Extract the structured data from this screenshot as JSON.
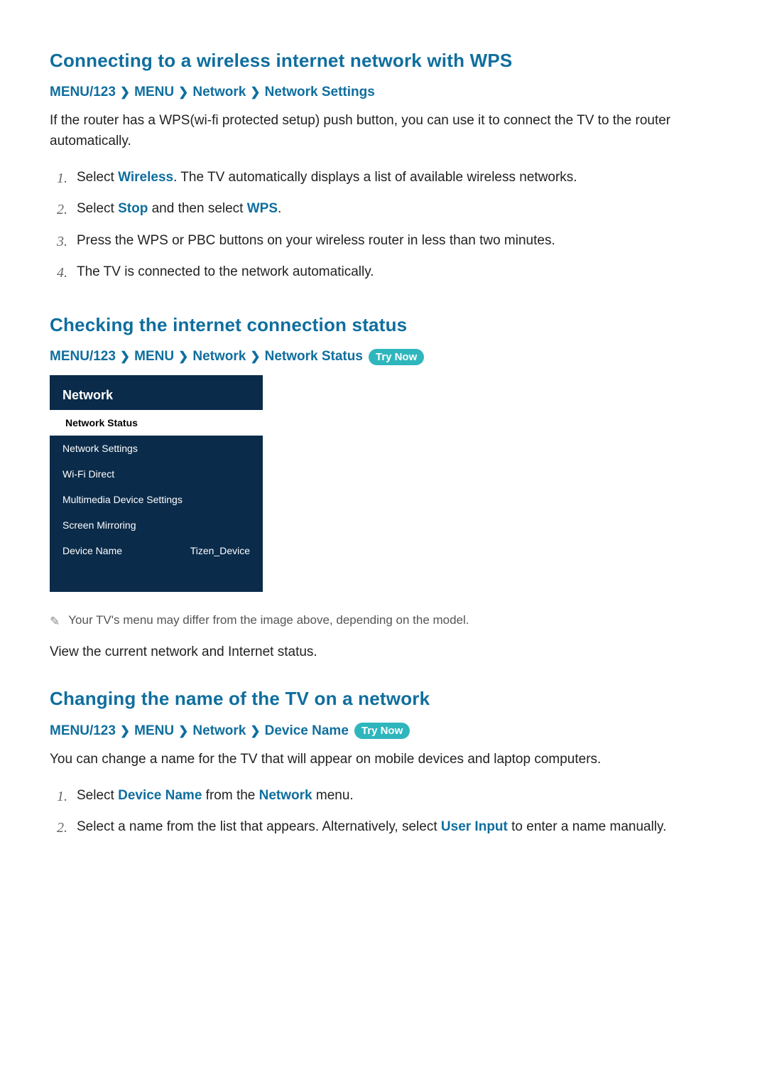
{
  "section1": {
    "heading": "Connecting to a wireless internet network with WPS",
    "crumb1": "MENU/123",
    "crumb2": "MENU",
    "crumb3": "Network",
    "crumb4": "Network Settings",
    "intro": "If the router has a WPS(wi-fi protected setup) push button, you can use it to connect the TV to the router automatically.",
    "step1_pre": "Select ",
    "step1_accent": "Wireless",
    "step1_post": ". The TV automatically displays a list of available wireless networks.",
    "step2_pre": "Select ",
    "step2_accent1": "Stop",
    "step2_mid": " and then select ",
    "step2_accent2": "WPS",
    "step2_post": ".",
    "step3": "Press the WPS or PBC buttons on your wireless router in less than two minutes.",
    "step4": "The TV is connected to the network automatically."
  },
  "section2": {
    "heading": "Checking the internet connection status",
    "crumb1": "MENU/123",
    "crumb2": "MENU",
    "crumb3": "Network",
    "crumb4": "Network Status",
    "trynow": "Try Now",
    "menu_title": "Network",
    "items": [
      {
        "label": "Network Status",
        "value": "",
        "selected": true
      },
      {
        "label": "Network Settings",
        "value": "",
        "selected": false
      },
      {
        "label": "Wi-Fi Direct",
        "value": "",
        "selected": false
      },
      {
        "label": "Multimedia Device Settings",
        "value": "",
        "selected": false
      },
      {
        "label": "Screen Mirroring",
        "value": "",
        "selected": false
      },
      {
        "label": "Device Name",
        "value": "Tizen_Device",
        "selected": false
      }
    ],
    "note": "Your TV's menu may differ from the image above, depending on the model.",
    "body": "View the current network and Internet status."
  },
  "section3": {
    "heading": "Changing the name of the TV on a network",
    "crumb1": "MENU/123",
    "crumb2": "MENU",
    "crumb3": "Network",
    "crumb4": "Device Name",
    "trynow": "Try Now",
    "body": "You can change a name for the TV that will appear on mobile devices and laptop computers.",
    "step1_pre": "Select ",
    "step1_accent1": "Device Name",
    "step1_mid": " from the ",
    "step1_accent2": "Network",
    "step1_post": " menu.",
    "step2_pre": "Select a name from the list that appears. Alternatively, select ",
    "step2_accent": "User Input",
    "step2_post": " to enter a name manually."
  },
  "sep": "❯"
}
